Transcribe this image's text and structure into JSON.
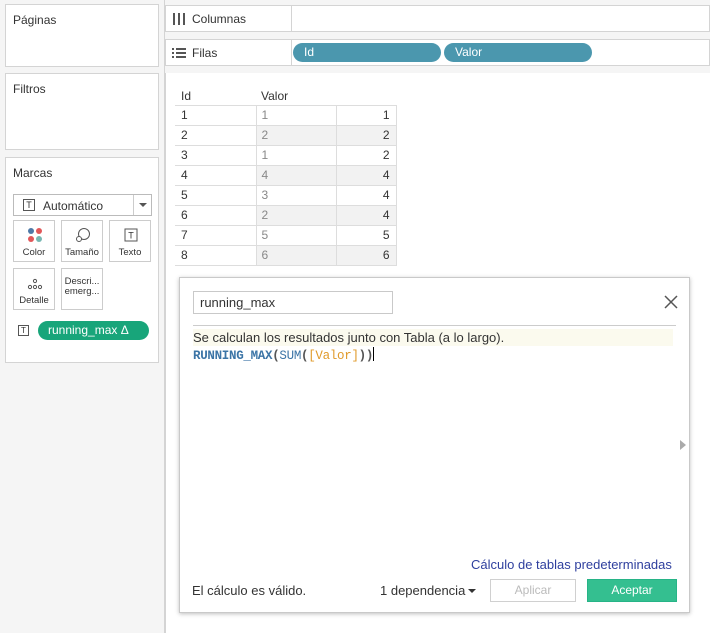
{
  "cards": {
    "paginas": "Páginas",
    "filtros": "Filtros",
    "marcas": "Marcas"
  },
  "marks": {
    "type_label": "Automático",
    "buttons": {
      "color": "Color",
      "tamano": "Tamaño",
      "texto": "Texto",
      "detalle": "Detalle",
      "descripcion": "Descri... emerg..."
    },
    "pill": "running_max Δ",
    "pill_color": "#18a57a"
  },
  "shelves": {
    "columnas": "Columnas",
    "filas": "Filas",
    "row_pills": [
      "Id",
      "Valor"
    ],
    "pill_color": "#4b97ae"
  },
  "table": {
    "headers": [
      "Id",
      "Valor"
    ],
    "rows": [
      [
        "1",
        "1",
        "1"
      ],
      [
        "2",
        "2",
        "2"
      ],
      [
        "3",
        "1",
        "2"
      ],
      [
        "4",
        "4",
        "4"
      ],
      [
        "5",
        "3",
        "4"
      ],
      [
        "6",
        "2",
        "4"
      ],
      [
        "7",
        "5",
        "5"
      ],
      [
        "8",
        "6",
        "6"
      ]
    ]
  },
  "dialog": {
    "name": "running_max",
    "info": "Se calculan los resultados junto con Tabla (a lo largo).",
    "formula": {
      "fn": "RUNNING_MAX",
      "inner_fn": "SUM",
      "field": "[Valor]"
    },
    "default_link": "Cálculo de tablas predeterminadas",
    "status": "El cálculo es válido.",
    "dependency": "1 dependencia",
    "apply": "Aplicar",
    "accept": "Aceptar",
    "accept_color": "#34bf90"
  }
}
